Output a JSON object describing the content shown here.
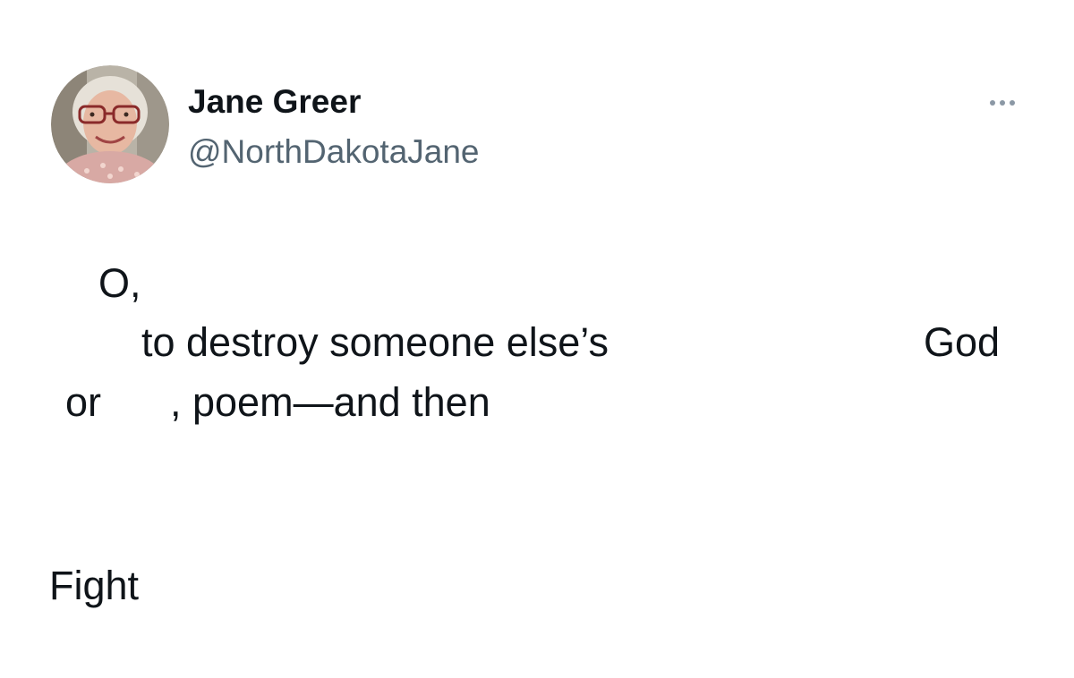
{
  "post": {
    "author": {
      "display_name": "Jane Greer",
      "handle": "@NorthDakotaJane",
      "avatar_icon": "profile-photo"
    },
    "more_icon": "ellipsis-icon",
    "body": {
      "line1": "O,",
      "line2_a": "to destroy someone else’s",
      "line2_b": "God",
      "line3_a": "or",
      "line3_b": ", poem—and then",
      "line4": "Fight"
    }
  }
}
